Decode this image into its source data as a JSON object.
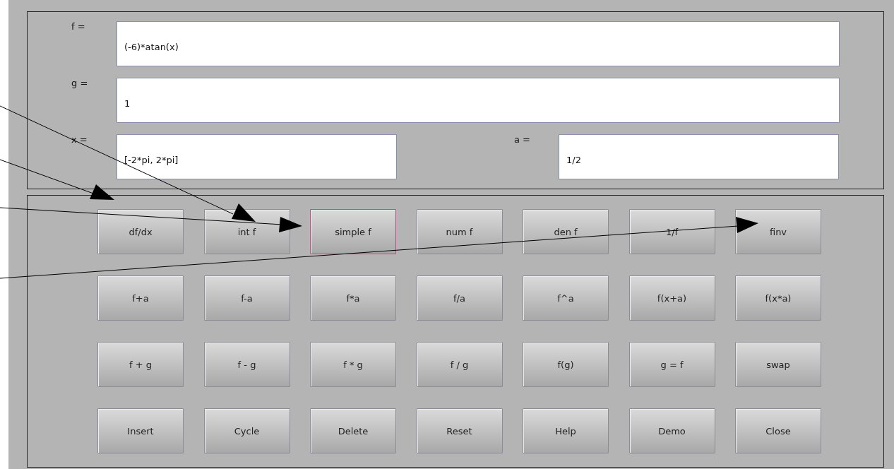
{
  "fields": [
    {
      "label": "f =",
      "value": "(-6)*atan(x)"
    },
    {
      "label": "g =",
      "value": "1"
    }
  ],
  "range_row": [
    {
      "label": "x =",
      "value": "[-2*pi, 2*pi]"
    },
    {
      "label": "a =",
      "value": "1/2"
    }
  ],
  "buttons": [
    [
      {
        "label": "df/dx",
        "selected": false
      },
      {
        "label": "int f",
        "selected": false
      },
      {
        "label": "simple f",
        "selected": true
      },
      {
        "label": "num f",
        "selected": false
      },
      {
        "label": "den f",
        "selected": false
      },
      {
        "label": "1/f",
        "selected": false
      },
      {
        "label": "finv",
        "selected": false
      }
    ],
    [
      {
        "label": "f+a",
        "selected": false
      },
      {
        "label": "f-a",
        "selected": false
      },
      {
        "label": "f*a",
        "selected": false
      },
      {
        "label": "f/a",
        "selected": false
      },
      {
        "label": "f^a",
        "selected": false
      },
      {
        "label": "f(x+a)",
        "selected": false
      },
      {
        "label": "f(x*a)",
        "selected": false
      }
    ],
    [
      {
        "label": "f + g",
        "selected": false
      },
      {
        "label": "f - g",
        "selected": false
      },
      {
        "label": "f * g",
        "selected": false
      },
      {
        "label": "f / g",
        "selected": false
      },
      {
        "label": "f(g)",
        "selected": false
      },
      {
        "label": "g = f",
        "selected": false
      },
      {
        "label": "swap",
        "selected": false
      }
    ],
    [
      {
        "label": "Insert",
        "selected": false
      },
      {
        "label": "Cycle",
        "selected": false
      },
      {
        "label": "Delete",
        "selected": false
      },
      {
        "label": "Reset",
        "selected": false
      },
      {
        "label": "Help",
        "selected": false
      },
      {
        "label": "Demo",
        "selected": false
      },
      {
        "label": "Close",
        "selected": false
      }
    ]
  ]
}
